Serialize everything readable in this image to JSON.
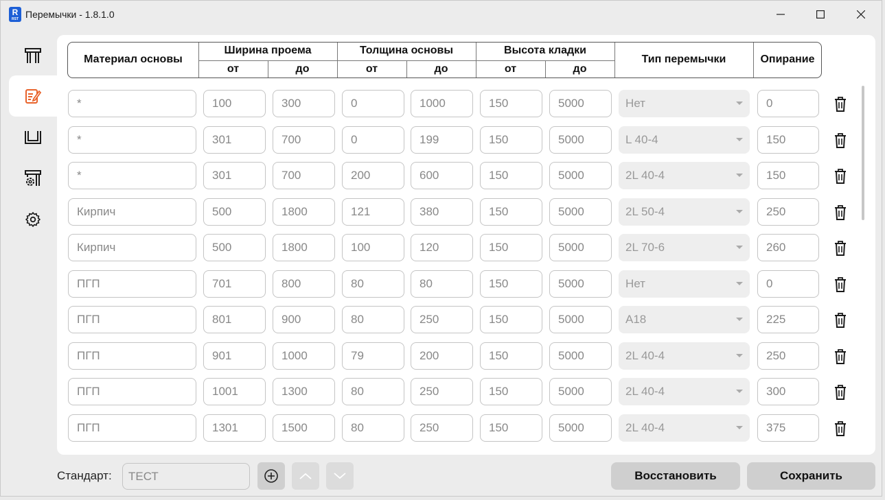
{
  "window": {
    "title": "Перемычки - 1.8.1.0",
    "logo_letter": "R"
  },
  "sidebar": {
    "items": [
      {
        "name": "sidebar-item-lintel",
        "icon": "lintel-icon",
        "active": false
      },
      {
        "name": "sidebar-item-rules",
        "icon": "edit-document-icon",
        "active": true
      },
      {
        "name": "sidebar-item-profile",
        "icon": "profile-icon",
        "active": false
      },
      {
        "name": "sidebar-item-settings-lintel",
        "icon": "lintel-settings-icon",
        "active": false
      },
      {
        "name": "sidebar-item-settings",
        "icon": "gear-icon",
        "active": false
      }
    ]
  },
  "table": {
    "headers": {
      "material": "Материал основы",
      "width": "Ширина проема",
      "thickness": "Толщина основы",
      "height": "Высота кладки",
      "type": "Тип перемычки",
      "support": "Опирание",
      "from": "от",
      "to": "до"
    },
    "rows": [
      [
        "*",
        "100",
        "300",
        "0",
        "1000",
        "150",
        "5000",
        "Нет",
        "0"
      ],
      [
        "*",
        "301",
        "700",
        "0",
        "199",
        "150",
        "5000",
        "L 40-4",
        "150"
      ],
      [
        "*",
        "301",
        "700",
        "200",
        "600",
        "150",
        "5000",
        "2L 40-4",
        "150"
      ],
      [
        "Кирпич",
        "500",
        "1800",
        "121",
        "380",
        "150",
        "5000",
        "2L 50-4",
        "250"
      ],
      [
        "Кирпич",
        "500",
        "1800",
        "100",
        "120",
        "150",
        "5000",
        "2L 70-6",
        "260"
      ],
      [
        "ПГП",
        "701",
        "800",
        "80",
        "80",
        "150",
        "5000",
        "Нет",
        "0"
      ],
      [
        "ПГП",
        "801",
        "900",
        "80",
        "250",
        "150",
        "5000",
        "А18",
        "225"
      ],
      [
        "ПГП",
        "901",
        "1000",
        "79",
        "200",
        "150",
        "5000",
        "2L 40-4",
        "250"
      ],
      [
        "ПГП",
        "1001",
        "1300",
        "80",
        "250",
        "150",
        "5000",
        "2L 40-4",
        "300"
      ],
      [
        "ПГП",
        "1301",
        "1500",
        "80",
        "250",
        "150",
        "5000",
        "2L 40-4",
        "375"
      ]
    ]
  },
  "footer": {
    "standard_label": "Стандарт:",
    "standard_value": "ТЕСТ",
    "restore_label": "Восстановить",
    "save_label": "Сохранить"
  }
}
